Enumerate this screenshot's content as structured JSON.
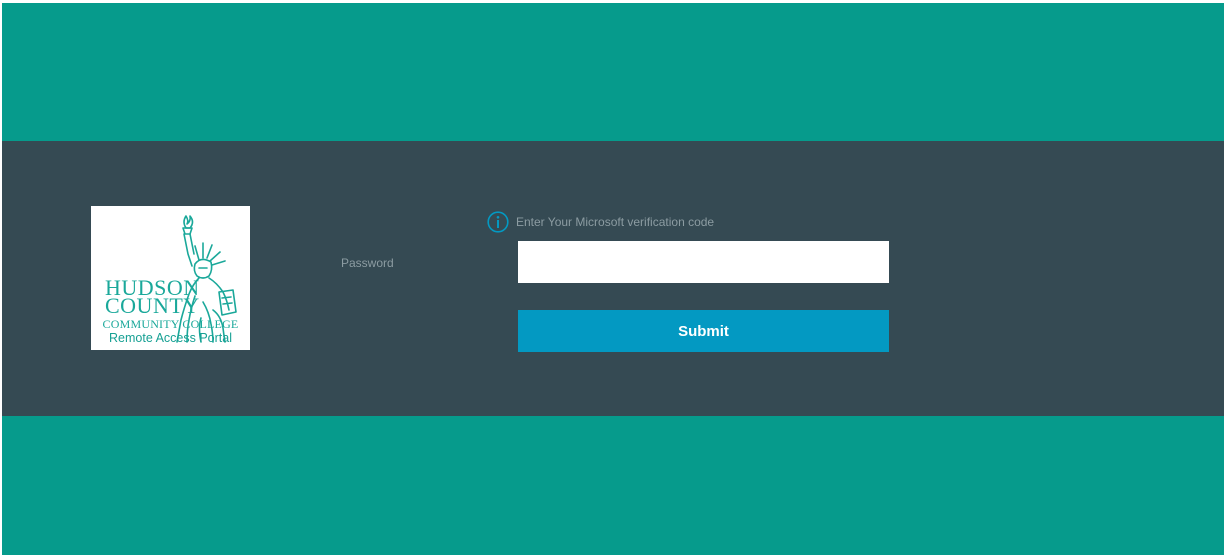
{
  "logo": {
    "line1": "HUDSON",
    "line2": "COUNTY",
    "line3": "COMMUNITY COLLEGE",
    "line4": "Remote Access Portal",
    "icon": "statue-of-liberty"
  },
  "form": {
    "password_label": "Password",
    "info_text": "Enter Your Microsoft verification code",
    "password_value": "",
    "submit_label": "Submit"
  },
  "colors": {
    "teal_band": "#069b8c",
    "slate_band": "#354a53",
    "submit_blue": "#0399c2",
    "label_gray": "#8c9ca2",
    "logo_teal": "#1aa89a"
  },
  "icons": {
    "info": "info-circle-icon"
  }
}
